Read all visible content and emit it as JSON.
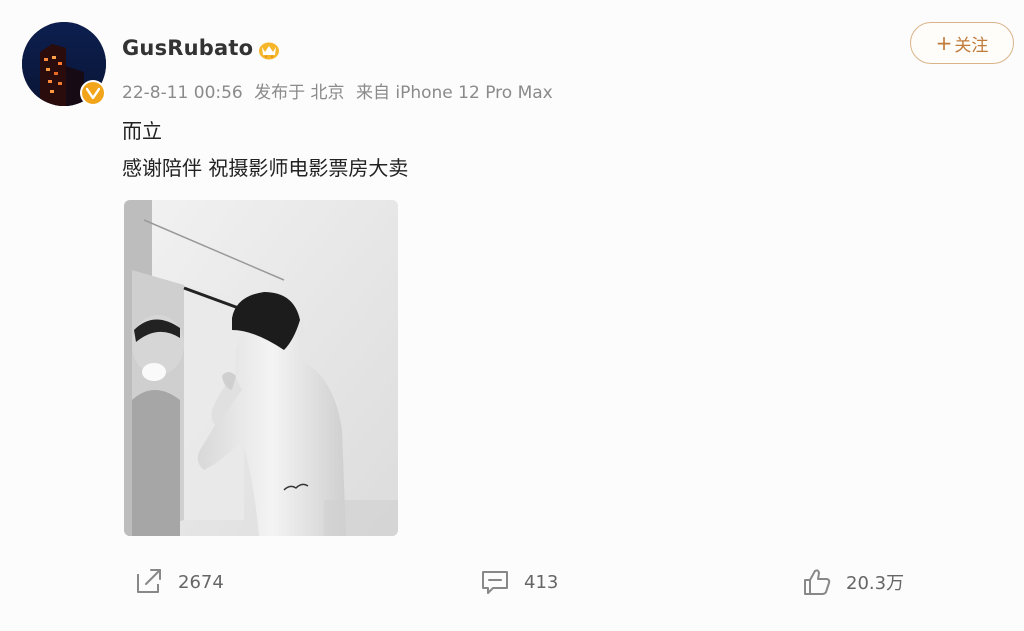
{
  "post": {
    "author": {
      "name": "GusRubato",
      "verified": true,
      "vip": true
    },
    "meta": {
      "time": "22-8-11 00:56",
      "location": "发布于 北京",
      "source": "来自 iPhone 12 Pro Max"
    },
    "follow_label": "关注",
    "text_lines": [
      "而立",
      "感谢陪伴 祝摄影师电影票房大卖"
    ],
    "actions": {
      "repost_count": "2674",
      "comment_count": "413",
      "like_count": "20.3万"
    }
  },
  "colors": {
    "follow_accent": "#c07a3a",
    "follow_border": "#d9b48a",
    "verified_badge": "#f2a51a",
    "meta_text": "#8a8a8a"
  },
  "icons": [
    "verified-badge-icon",
    "vip-crown-icon",
    "repost-icon",
    "comment-icon",
    "like-icon"
  ]
}
